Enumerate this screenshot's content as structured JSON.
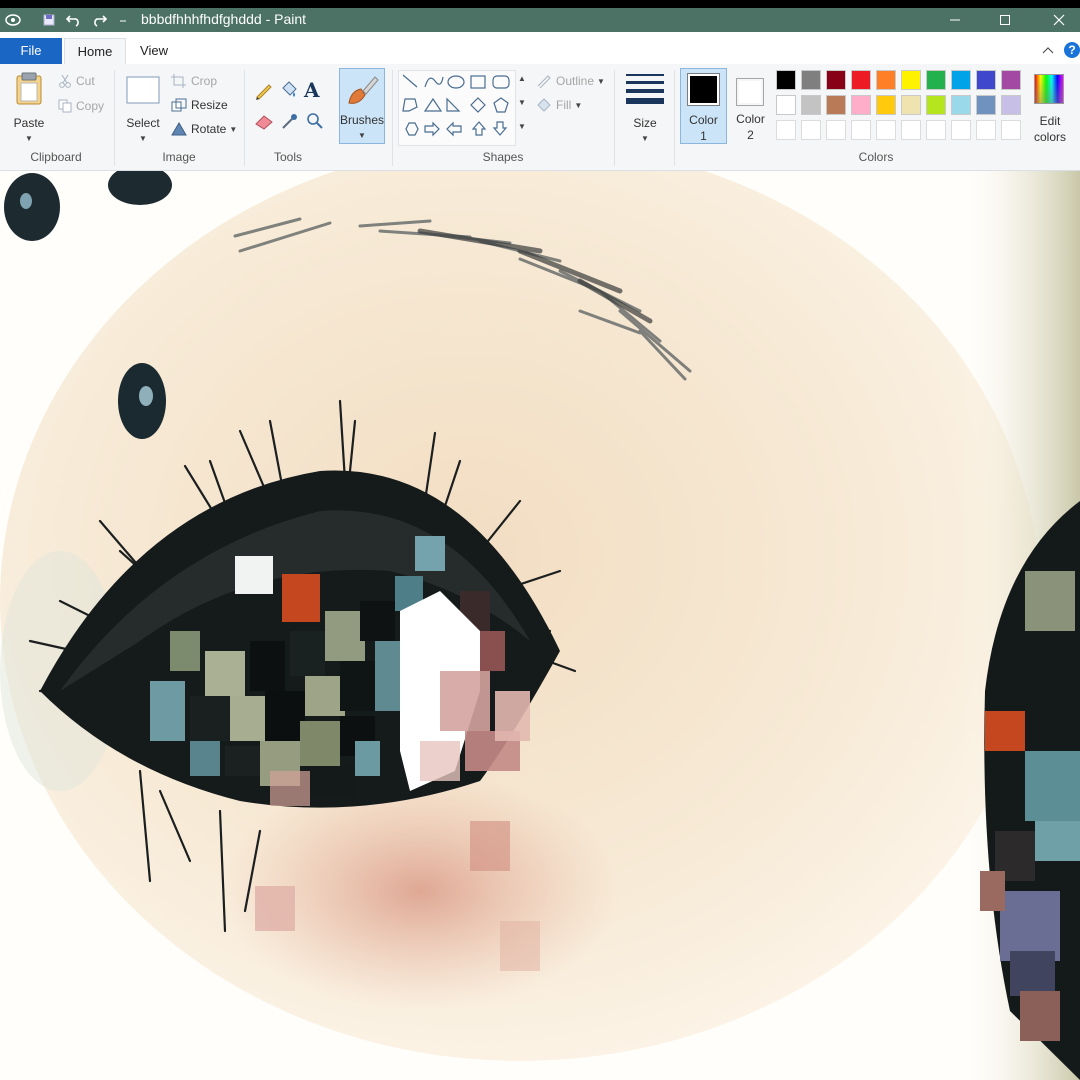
{
  "window": {
    "title": "bbbdfhhhfhdfghddd - Paint",
    "bar_color": "#4b7264"
  },
  "tabs": [
    {
      "label": "File"
    },
    {
      "label": "Home"
    },
    {
      "label": "View"
    }
  ],
  "clipboard": {
    "paste": "Paste",
    "cut": "Cut",
    "copy": "Copy",
    "group": "Clipboard"
  },
  "image": {
    "select": "Select",
    "crop": "Crop",
    "resize": "Resize",
    "rotate": "Rotate",
    "group": "Image"
  },
  "tools": {
    "group": "Tools",
    "brushes": "Brushes"
  },
  "shapes": {
    "outline": "Outline",
    "fill": "Fill",
    "group": "Shapes"
  },
  "size": {
    "label": "Size"
  },
  "color1": {
    "label": "Color",
    "num": "1",
    "value": "#000000"
  },
  "color2": {
    "label": "Color",
    "num": "2",
    "value": "#ffffff"
  },
  "colors": {
    "group": "Colors",
    "edit_line1": "Edit",
    "edit_line2": "colors"
  },
  "palette_row1": [
    "#000000",
    "#7f7f7f",
    "#880015",
    "#ed1c24",
    "#ff7f27",
    "#fff200",
    "#22b14c",
    "#00a2e8",
    "#3f48cc",
    "#a349a4"
  ],
  "palette_row2": [
    "#ffffff",
    "#c3c3c3",
    "#b97a57",
    "#ffaec9",
    "#ffc90e",
    "#efe4b0",
    "#b5e61d",
    "#99d9ea",
    "#7092be",
    "#c8bfe7"
  ]
}
